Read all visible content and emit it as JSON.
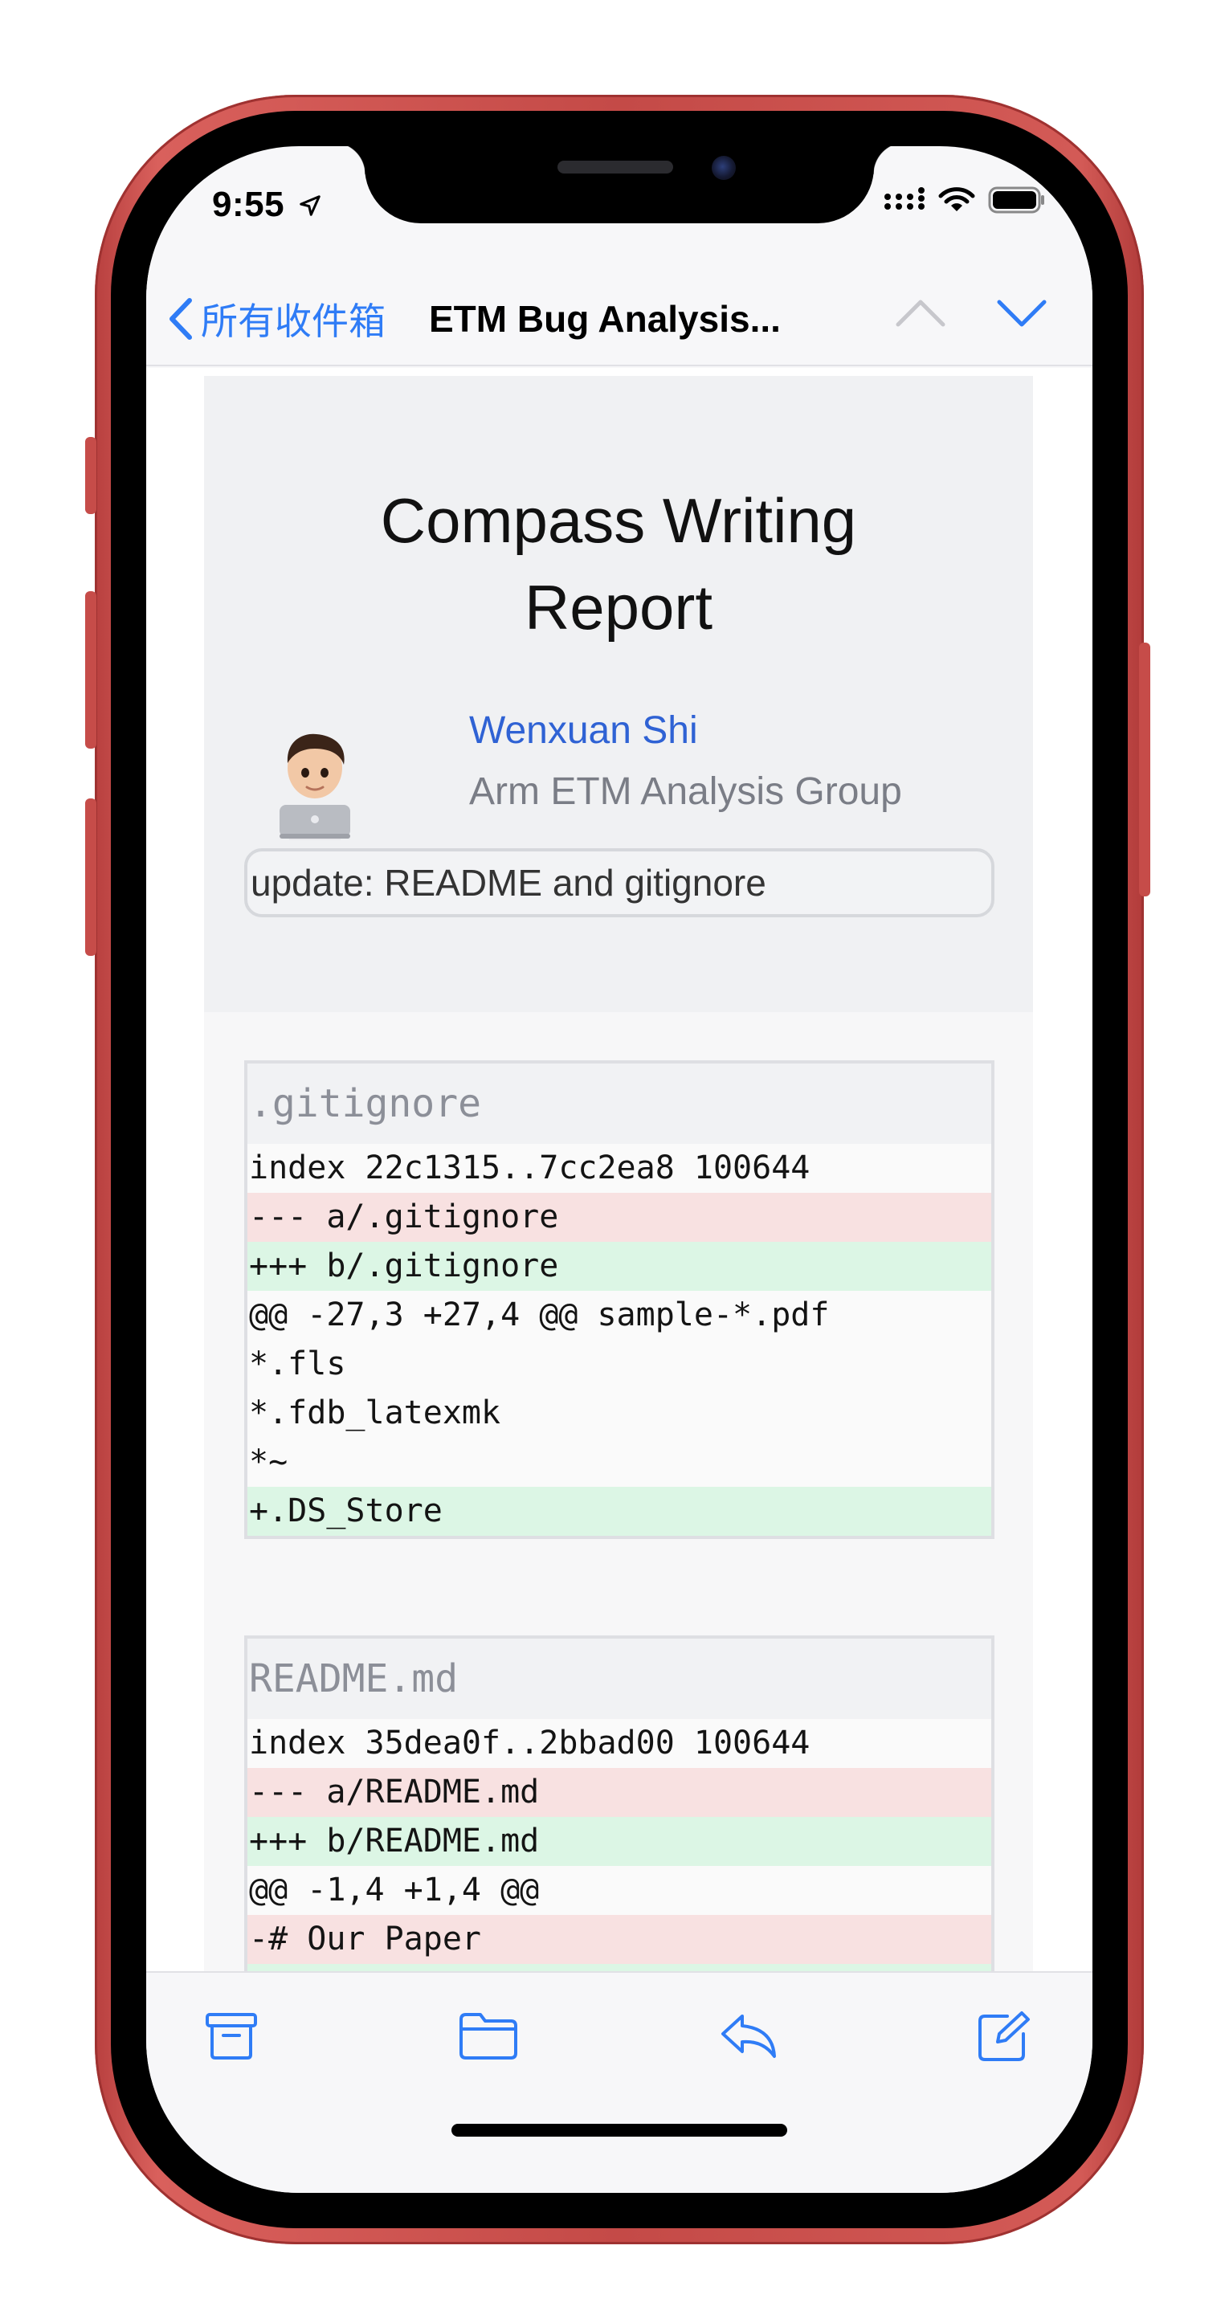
{
  "status_bar": {
    "time": "9:55",
    "icons": [
      "location-arrow-icon",
      "cellular-signal-icon",
      "wifi-icon",
      "battery-icon"
    ]
  },
  "nav": {
    "back_label": "所有收件箱",
    "title": "ETM Bug Analysis...",
    "up_enabled": false,
    "down_enabled": true
  },
  "email": {
    "report_title_line1": "Compass Writing",
    "report_title_line2": "Report",
    "author_name": "Wenxuan Shi",
    "author_group": "Arm ETM Analysis Group",
    "commit_message": "update: README and gitignore",
    "diffs": [
      {
        "filename": ".gitignore",
        "lines": [
          {
            "type": "context",
            "text": "index 22c1315..7cc2ea8 100644"
          },
          {
            "type": "del",
            "text": "--- a/.gitignore"
          },
          {
            "type": "add",
            "text": "+++ b/.gitignore"
          },
          {
            "type": "context",
            "text": "@@ -27,3 +27,4 @@ sample-*.pdf"
          },
          {
            "type": "context",
            "text": "*.fls"
          },
          {
            "type": "context",
            "text": "*.fdb_latexmk"
          },
          {
            "type": "context",
            "text": "*~"
          },
          {
            "type": "add",
            "text": "+.DS_Store"
          }
        ]
      },
      {
        "filename": "README.md",
        "lines": [
          {
            "type": "context",
            "text": "index 35dea0f..2bbad00 100644"
          },
          {
            "type": "del",
            "text": "--- a/README.md"
          },
          {
            "type": "add",
            "text": "+++ b/README.md"
          },
          {
            "type": "context",
            "text": "@@ -1,4 +1,4 @@"
          },
          {
            "type": "del",
            "text": "-# Our Paper"
          }
        ]
      }
    ]
  },
  "toolbar": {
    "items": [
      "archive-icon",
      "folder-icon",
      "reply-icon",
      "compose-icon"
    ]
  },
  "colors": {
    "accent": "#2f7cf6",
    "frame": "#c94f4c",
    "diff_add": "#dcf6e5",
    "diff_del": "#f8e1e1"
  }
}
